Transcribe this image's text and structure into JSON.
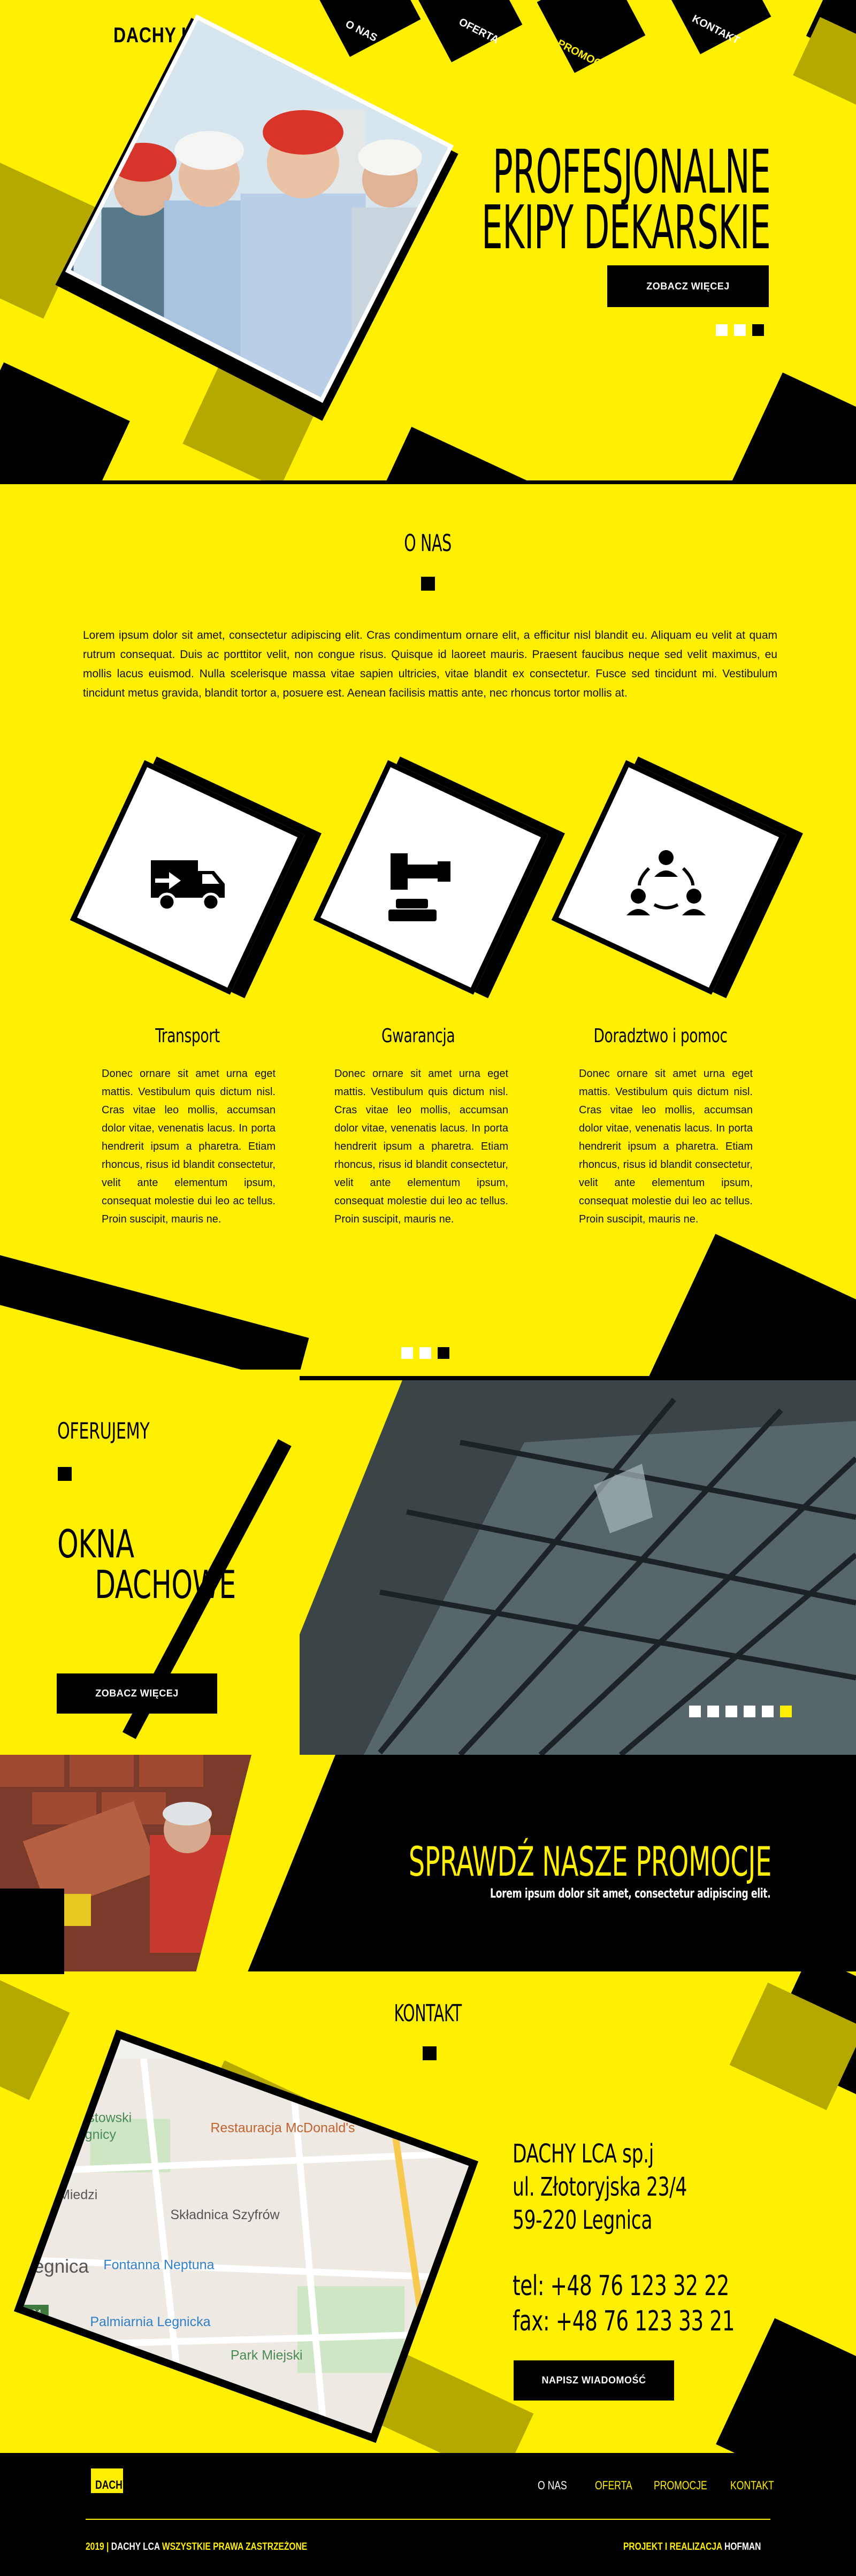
{
  "brand": {
    "name": "DACHY LCA"
  },
  "nav": {
    "items": [
      {
        "label": "O NAS"
      },
      {
        "label": "OFERTA"
      },
      {
        "label": "PROMOCJE"
      },
      {
        "label": "KONTAKT"
      }
    ]
  },
  "hero": {
    "title_line1": "PROFESJONALNE",
    "title_line2": "EKIPY DEKARSKIE",
    "button": "ZOBACZ WIĘCEJ",
    "slides_total": 3,
    "slide_active": 3
  },
  "about": {
    "title": "O NAS",
    "text": "Lorem ipsum dolor sit amet, consectetur adipiscing elit. Cras condimentum ornare elit, a efficitur nisl blandit eu. Aliquam eu velit at quam rutrum consequat. Duis ac porttitor velit, non congue risus. Quisque id laoreet mauris. Praesent faucibus neque sed velit maximus, eu mollis lacus euismod. Nulla scelerisque massa vitae sapien ultricies, vitae blandit ex consectetur. Fusce sed tincidunt mi. Vestibulum tincidunt metus gravida, blandit tortor a, posuere est. Aenean facilisis mattis ante, nec rhoncus tortor mollis at.",
    "features": [
      {
        "title": "Transport",
        "icon": "truck-icon",
        "text": "Donec ornare sit amet urna eget mattis. Vestibulum quis dictum nisl. Cras vitae leo mollis, accumsan dolor vitae, venenatis lacus. In porta hendrerit ipsum a pharetra. Etiam rhoncus, risus id blandit consectetur, velit ante elementum ipsum, consequat molestie dui leo ac tellus. Proin suscipit, mauris ne."
      },
      {
        "title": "Gwarancja",
        "icon": "gavel-icon",
        "text": "Donec ornare sit amet urna eget mattis. Vestibulum quis dictum nisl. Cras vitae leo mollis, accumsan dolor vitae, venenatis lacus. In porta hendrerit ipsum a pharetra. Etiam rhoncus, risus id blandit consectetur, velit ante elementum ipsum, consequat molestie dui leo ac tellus. Proin suscipit, mauris ne."
      },
      {
        "title": "Doradztwo i pomoc",
        "icon": "team-icon",
        "text": "Donec ornare sit amet urna eget mattis. Vestibulum quis dictum nisl. Cras vitae leo mollis, accumsan dolor vitae, venenatis lacus. In porta hendrerit ipsum a pharetra. Etiam rhoncus, risus id blandit consectetur, velit ante elementum ipsum, consequat molestie dui leo ac tellus. Proin suscipit, mauris ne."
      }
    ],
    "slides_total": 3,
    "slide_active": 3
  },
  "offer": {
    "kicker": "OFERUJEMY",
    "title_line1": "OKNA",
    "title_line2": "DACHOWE",
    "button": "ZOBACZ WIĘCEJ",
    "slides_total": 6,
    "slide_active": 6
  },
  "promo": {
    "title": "SPRAWDŹ NASZE PROMOCJE",
    "subtitle": "Lorem ipsum dolor sit amet, consectetur adipiscing elit."
  },
  "contact": {
    "title": "KONTAKT",
    "company": "DACHY LCA sp.j",
    "street": "ul. Złotoryjska 23/4",
    "city": "59-220 Legnica",
    "phone": "tel: +48 76 123 32 22",
    "fax": "fax: +48 76 123 33 21",
    "button": "NAPISZ WIADOMOŚĆ",
    "map_labels": [
      "nek Piastowski",
      "w Legnicy",
      "Restauracja McDonald's",
      "um Miedzi",
      "Składnica Szyfrów",
      "Legnica",
      "Fontanna Neptuna",
      "Palmiarnia Legnicka",
      "Park Miejski",
      "364"
    ]
  },
  "footer": {
    "brand": "DACHY LCA",
    "links": [
      "O NAS",
      "OFERTA",
      "PROMOCJE",
      "KONTAKT"
    ],
    "copyright_year": "2019",
    "copyright_sep": "|",
    "copyright_brand": "DACHY LCA",
    "copyright_text": "WSZYSTKIE PRAWA ZASTRZEŻONE",
    "credit_text": "PROJEKT I REALIZACJA",
    "credit_name": "HOFMAN"
  },
  "colors": {
    "accent": "#ffef00",
    "dark": "#000000",
    "olive": "#b5a900"
  }
}
